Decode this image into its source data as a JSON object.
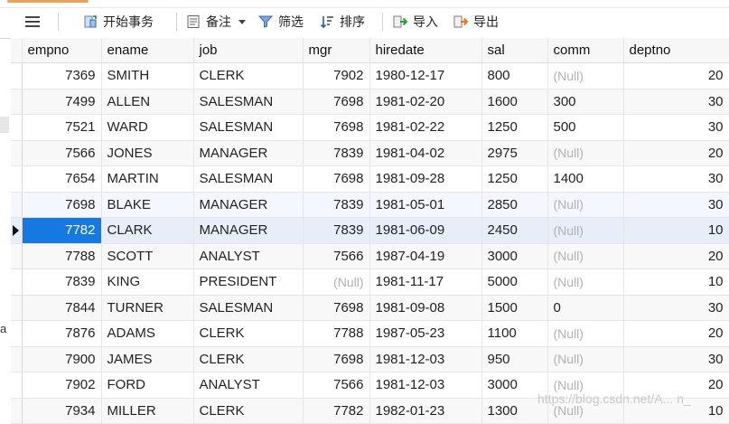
{
  "toolbar": {
    "begin_transaction": "开始事务",
    "note": "备注",
    "filter": "筛选",
    "sort": "排序",
    "import": "导入",
    "export": "导出"
  },
  "table": {
    "columns": [
      "empno",
      "ename",
      "job",
      "mgr",
      "hiredate",
      "sal",
      "comm",
      "deptno"
    ],
    "rows": [
      [
        "7369",
        "SMITH",
        "CLERK",
        "7902",
        "1980-12-17",
        "800",
        "(Null)",
        "20"
      ],
      [
        "7499",
        "ALLEN",
        "SALESMAN",
        "7698",
        "1981-02-20",
        "1600",
        "300",
        "30"
      ],
      [
        "7521",
        "WARD",
        "SALESMAN",
        "7698",
        "1981-02-22",
        "1250",
        "500",
        "30"
      ],
      [
        "7566",
        "JONES",
        "MANAGER",
        "7839",
        "1981-04-02",
        "2975",
        "(Null)",
        "20"
      ],
      [
        "7654",
        "MARTIN",
        "SALESMAN",
        "7698",
        "1981-09-28",
        "1250",
        "1400",
        "30"
      ],
      [
        "7698",
        "BLAKE",
        "MANAGER",
        "7839",
        "1981-05-01",
        "2850",
        "(Null)",
        "30"
      ],
      [
        "7782",
        "CLARK",
        "MANAGER",
        "7839",
        "1981-06-09",
        "2450",
        "(Null)",
        "10"
      ],
      [
        "7788",
        "SCOTT",
        "ANALYST",
        "7566",
        "1987-04-19",
        "3000",
        "(Null)",
        "20"
      ],
      [
        "7839",
        "KING",
        "PRESIDENT",
        "(Null)",
        "1981-11-17",
        "5000",
        "(Null)",
        "10"
      ],
      [
        "7844",
        "TURNER",
        "SALESMAN",
        "7698",
        "1981-09-08",
        "1500",
        "0",
        "30"
      ],
      [
        "7876",
        "ADAMS",
        "CLERK",
        "7788",
        "1987-05-23",
        "1100",
        "(Null)",
        "20"
      ],
      [
        "7900",
        "JAMES",
        "CLERK",
        "7698",
        "1981-12-03",
        "950",
        "(Null)",
        "30"
      ],
      [
        "7902",
        "FORD",
        "ANALYST",
        "7566",
        "1981-12-03",
        "3000",
        "(Null)",
        "20"
      ],
      [
        "7934",
        "MILLER",
        "CLERK",
        "7782",
        "1982-01-23",
        "1300",
        "(Null)",
        "10"
      ]
    ],
    "current_row_index": 6
  },
  "left_edge_text": "a",
  "watermark": "https://blog.csdn.net/A... n_"
}
